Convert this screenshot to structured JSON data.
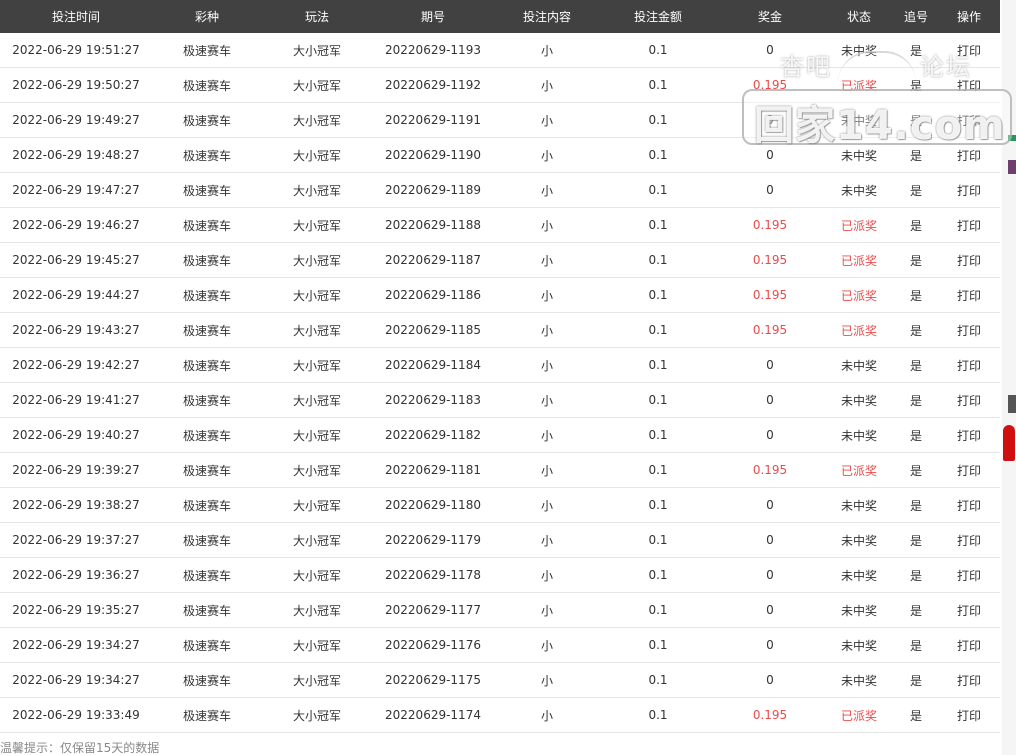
{
  "table": {
    "headers": [
      "投注时间",
      "彩种",
      "玩法",
      "期号",
      "投注内容",
      "投注金额",
      "奖金",
      "状态",
      "追号",
      "操作"
    ],
    "rows": [
      {
        "time": "2022-06-29 19:51:27",
        "lottery": "极速赛车",
        "play": "大小冠军",
        "issue": "20220629-1193",
        "content": "小",
        "amount": "0.1",
        "prize": "0",
        "status": "未中奖",
        "chase": "是",
        "op": "打印",
        "won": false
      },
      {
        "time": "2022-06-29 19:50:27",
        "lottery": "极速赛车",
        "play": "大小冠军",
        "issue": "20220629-1192",
        "content": "小",
        "amount": "0.1",
        "prize": "0.195",
        "status": "已派奖",
        "chase": "是",
        "op": "打印",
        "won": true
      },
      {
        "time": "2022-06-29 19:49:27",
        "lottery": "极速赛车",
        "play": "大小冠军",
        "issue": "20220629-1191",
        "content": "小",
        "amount": "0.1",
        "prize": "0",
        "status": "未中奖",
        "chase": "是",
        "op": "打印",
        "won": false
      },
      {
        "time": "2022-06-29 19:48:27",
        "lottery": "极速赛车",
        "play": "大小冠军",
        "issue": "20220629-1190",
        "content": "小",
        "amount": "0.1",
        "prize": "0",
        "status": "未中奖",
        "chase": "是",
        "op": "打印",
        "won": false
      },
      {
        "time": "2022-06-29 19:47:27",
        "lottery": "极速赛车",
        "play": "大小冠军",
        "issue": "20220629-1189",
        "content": "小",
        "amount": "0.1",
        "prize": "0",
        "status": "未中奖",
        "chase": "是",
        "op": "打印",
        "won": false
      },
      {
        "time": "2022-06-29 19:46:27",
        "lottery": "极速赛车",
        "play": "大小冠军",
        "issue": "20220629-1188",
        "content": "小",
        "amount": "0.1",
        "prize": "0.195",
        "status": "已派奖",
        "chase": "是",
        "op": "打印",
        "won": true
      },
      {
        "time": "2022-06-29 19:45:27",
        "lottery": "极速赛车",
        "play": "大小冠军",
        "issue": "20220629-1187",
        "content": "小",
        "amount": "0.1",
        "prize": "0.195",
        "status": "已派奖",
        "chase": "是",
        "op": "打印",
        "won": true
      },
      {
        "time": "2022-06-29 19:44:27",
        "lottery": "极速赛车",
        "play": "大小冠军",
        "issue": "20220629-1186",
        "content": "小",
        "amount": "0.1",
        "prize": "0.195",
        "status": "已派奖",
        "chase": "是",
        "op": "打印",
        "won": true
      },
      {
        "time": "2022-06-29 19:43:27",
        "lottery": "极速赛车",
        "play": "大小冠军",
        "issue": "20220629-1185",
        "content": "小",
        "amount": "0.1",
        "prize": "0.195",
        "status": "已派奖",
        "chase": "是",
        "op": "打印",
        "won": true
      },
      {
        "time": "2022-06-29 19:42:27",
        "lottery": "极速赛车",
        "play": "大小冠军",
        "issue": "20220629-1184",
        "content": "小",
        "amount": "0.1",
        "prize": "0",
        "status": "未中奖",
        "chase": "是",
        "op": "打印",
        "won": false
      },
      {
        "time": "2022-06-29 19:41:27",
        "lottery": "极速赛车",
        "play": "大小冠军",
        "issue": "20220629-1183",
        "content": "小",
        "amount": "0.1",
        "prize": "0",
        "status": "未中奖",
        "chase": "是",
        "op": "打印",
        "won": false
      },
      {
        "time": "2022-06-29 19:40:27",
        "lottery": "极速赛车",
        "play": "大小冠军",
        "issue": "20220629-1182",
        "content": "小",
        "amount": "0.1",
        "prize": "0",
        "status": "未中奖",
        "chase": "是",
        "op": "打印",
        "won": false
      },
      {
        "time": "2022-06-29 19:39:27",
        "lottery": "极速赛车",
        "play": "大小冠军",
        "issue": "20220629-1181",
        "content": "小",
        "amount": "0.1",
        "prize": "0.195",
        "status": "已派奖",
        "chase": "是",
        "op": "打印",
        "won": true
      },
      {
        "time": "2022-06-29 19:38:27",
        "lottery": "极速赛车",
        "play": "大小冠军",
        "issue": "20220629-1180",
        "content": "小",
        "amount": "0.1",
        "prize": "0",
        "status": "未中奖",
        "chase": "是",
        "op": "打印",
        "won": false
      },
      {
        "time": "2022-06-29 19:37:27",
        "lottery": "极速赛车",
        "play": "大小冠军",
        "issue": "20220629-1179",
        "content": "小",
        "amount": "0.1",
        "prize": "0",
        "status": "未中奖",
        "chase": "是",
        "op": "打印",
        "won": false
      },
      {
        "time": "2022-06-29 19:36:27",
        "lottery": "极速赛车",
        "play": "大小冠军",
        "issue": "20220629-1178",
        "content": "小",
        "amount": "0.1",
        "prize": "0",
        "status": "未中奖",
        "chase": "是",
        "op": "打印",
        "won": false
      },
      {
        "time": "2022-06-29 19:35:27",
        "lottery": "极速赛车",
        "play": "大小冠军",
        "issue": "20220629-1177",
        "content": "小",
        "amount": "0.1",
        "prize": "0",
        "status": "未中奖",
        "chase": "是",
        "op": "打印",
        "won": false
      },
      {
        "time": "2022-06-29 19:34:27",
        "lottery": "极速赛车",
        "play": "大小冠军",
        "issue": "20220629-1176",
        "content": "小",
        "amount": "0.1",
        "prize": "0",
        "status": "未中奖",
        "chase": "是",
        "op": "打印",
        "won": false
      },
      {
        "time": "2022-06-29 19:34:27",
        "lottery": "极速赛车",
        "play": "大小冠军",
        "issue": "20220629-1175",
        "content": "小",
        "amount": "0.1",
        "prize": "0",
        "status": "未中奖",
        "chase": "是",
        "op": "打印",
        "won": false
      },
      {
        "time": "2022-06-29 19:33:49",
        "lottery": "极速赛车",
        "play": "大小冠军",
        "issue": "20220629-1174",
        "content": "小",
        "amount": "0.1",
        "prize": "0.195",
        "status": "已派奖",
        "chase": "是",
        "op": "打印",
        "won": true
      }
    ]
  },
  "footer": {
    "tip": "温馨提示：仅保留15天的数据"
  },
  "watermark": {
    "left_text": "杏吧",
    "right_text": "论坛",
    "main_text": "回家14.com"
  },
  "colors": {
    "header_bg": "#414141",
    "won_text": "#e94b4b",
    "lantern": "#d01010"
  }
}
